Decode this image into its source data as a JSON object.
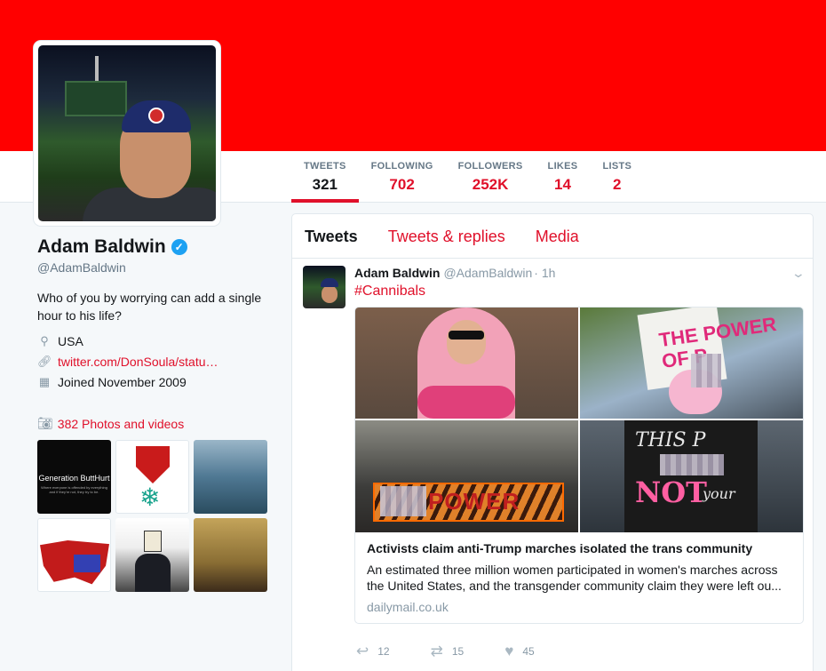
{
  "profile": {
    "name": "Adam Baldwin",
    "handle": "@AdamBaldwin",
    "bio": "Who of you by worrying can add a single hour to his life?",
    "location": "USA",
    "url": "twitter.com/DonSoula/statu…",
    "joined": "Joined November 2009",
    "photos_label": "382 Photos and videos",
    "banner_color": "#ff0000",
    "accent_color": "#e0102a"
  },
  "stats": [
    {
      "label": "TWEETS",
      "value": "321"
    },
    {
      "label": "FOLLOWING",
      "value": "702"
    },
    {
      "label": "FOLLOWERS",
      "value": "252K"
    },
    {
      "label": "LIKES",
      "value": "14"
    },
    {
      "label": "LISTS",
      "value": "2"
    }
  ],
  "thumbs": {
    "t1_title": "Generation ButtHurt",
    "t1_sub": "Where everyone is offended by everything and if they're not, they try to be."
  },
  "tabs": [
    "Tweets",
    "Tweets & replies",
    "Media"
  ],
  "tweet": {
    "name": "Adam Baldwin",
    "handle": "@AdamBaldwin",
    "time": "· 1h",
    "text": "#Cannibals",
    "card": {
      "title": "Activists claim anti-Trump marches isolated the trans community",
      "description": "An estimated three million women participated in women's marches across the United States, and the transgender community claim they were left ou...",
      "domain": "dailymail.co.uk",
      "img2_sign": "THE POWER OF P",
      "img3_banner": "POWER",
      "img4_sign_top": "THIS P",
      "img4_sign_not": "NOT",
      "img4_sign_your": "your"
    },
    "actions": {
      "reply": "12",
      "retweet": "15",
      "like": "45"
    }
  }
}
